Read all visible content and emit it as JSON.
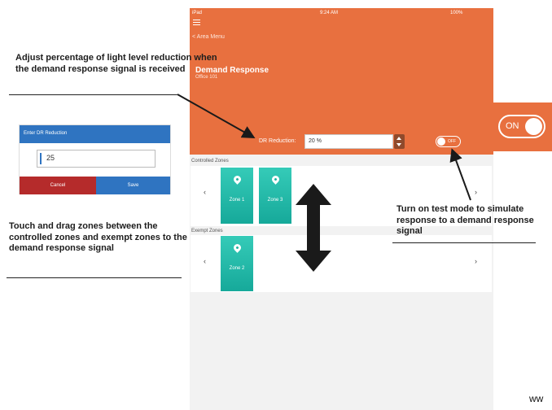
{
  "status_bar": {
    "carrier": "iPad",
    "time": "9:24 AM",
    "battery": "100%"
  },
  "nav": {
    "back_label": "< Area Menu"
  },
  "header": {
    "title": "Demand Response",
    "subtitle": "Office 101"
  },
  "dr_reduction": {
    "label": "DR Reduction:",
    "value": "20 %"
  },
  "test_mode": {
    "state_label": "OFF"
  },
  "controlled_zones": {
    "label": "Controlled Zones",
    "zones": [
      "Zone 1",
      "Zone 3"
    ]
  },
  "exempt_zones": {
    "label": "Exempt Zones",
    "zones": [
      "Zone 2"
    ]
  },
  "icons": {
    "back": "chevron-left-icon",
    "next": "chevron-right-icon",
    "zone": "location-pin-icon"
  },
  "callouts": {
    "reduction": "Adjust percentage of light level reduction when the demand response signal is received",
    "drag": "Touch and drag zones between the controlled zones and exempt zones to the demand response signal",
    "test_mode": "Turn on test mode to simulate response to a demand response signal"
  },
  "dialog": {
    "title": "Enter DR Reduction",
    "value": "25",
    "cancel_label": "Cancel",
    "save_label": "Save"
  },
  "on_toggle": {
    "label": "ON"
  },
  "watermark": "ww",
  "colors": {
    "brand_orange": "#e8703f",
    "zone_teal": "#22b3a2",
    "dialog_blue": "#2f74c1",
    "cancel_red": "#b52b2b"
  }
}
